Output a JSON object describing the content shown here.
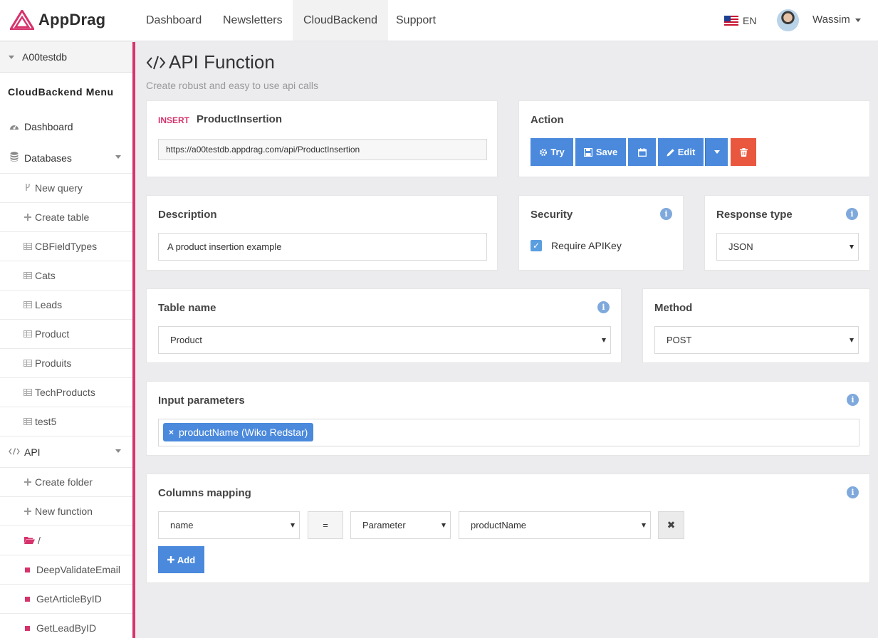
{
  "brand": {
    "name": "AppDrag",
    "logo_color": "#d6336c"
  },
  "nav": {
    "items": [
      {
        "label": "Dashboard"
      },
      {
        "label": "Newsletters"
      },
      {
        "label": "CloudBackend"
      },
      {
        "label": "Support"
      }
    ],
    "active": "CloudBackend",
    "language": "EN",
    "user_name": "Wassim"
  },
  "sidebar": {
    "db_name": "A00testdb",
    "menu_title": "CloudBackend Menu",
    "dashboard": "Dashboard",
    "databases": "Databases",
    "db_items": [
      {
        "label": "New query",
        "icon": "branch-icon"
      },
      {
        "label": "Create table",
        "icon": "plus-icon"
      },
      {
        "label": "CBFieldTypes",
        "icon": "table-icon"
      },
      {
        "label": "Cats",
        "icon": "table-icon"
      },
      {
        "label": "Leads",
        "icon": "table-icon"
      },
      {
        "label": "Product",
        "icon": "table-icon"
      },
      {
        "label": "Produits",
        "icon": "table-icon"
      },
      {
        "label": "TechProducts",
        "icon": "table-icon"
      },
      {
        "label": "test5",
        "icon": "table-icon"
      }
    ],
    "api": "API",
    "api_items": [
      {
        "label": "Create folder",
        "icon": "plus-icon"
      },
      {
        "label": "New function",
        "icon": "plus-icon"
      },
      {
        "label": "/",
        "icon": "folder-open-icon"
      },
      {
        "label": "DeepValidateEmail",
        "icon": "square-icon"
      },
      {
        "label": "GetArticleByID",
        "icon": "square-icon"
      },
      {
        "label": "GetLeadByID",
        "icon": "square-icon"
      }
    ],
    "accent": "#d6336c"
  },
  "page": {
    "title": "API Function",
    "subtitle": "Create robust and easy to use api calls"
  },
  "function_card": {
    "type_badge": "INSERT",
    "name": "ProductInsertion",
    "url": "https://a00testdb.appdrag.com/api/ProductInsertion"
  },
  "action_card": {
    "title": "Action",
    "try_label": "Try",
    "save_label": "Save",
    "edit_label": "Edit",
    "button_color": "#4a89dc",
    "delete_color": "#e9573f"
  },
  "description_card": {
    "title": "Description",
    "value": "A product insertion example"
  },
  "security_card": {
    "title": "Security",
    "require_apikey_label": "Require APIKey",
    "require_apikey_checked": true
  },
  "response_card": {
    "title": "Response type",
    "value": "JSON"
  },
  "table_card": {
    "title": "Table name",
    "value": "Product"
  },
  "method_card": {
    "title": "Method",
    "value": "POST"
  },
  "input_params_card": {
    "title": "Input parameters",
    "tags": [
      "productName (Wiko Redstar)"
    ]
  },
  "mapping_card": {
    "title": "Columns mapping",
    "rows": [
      {
        "column": "name",
        "operator": "=",
        "source": "Parameter",
        "value": "productName"
      }
    ],
    "add_label": "Add"
  }
}
